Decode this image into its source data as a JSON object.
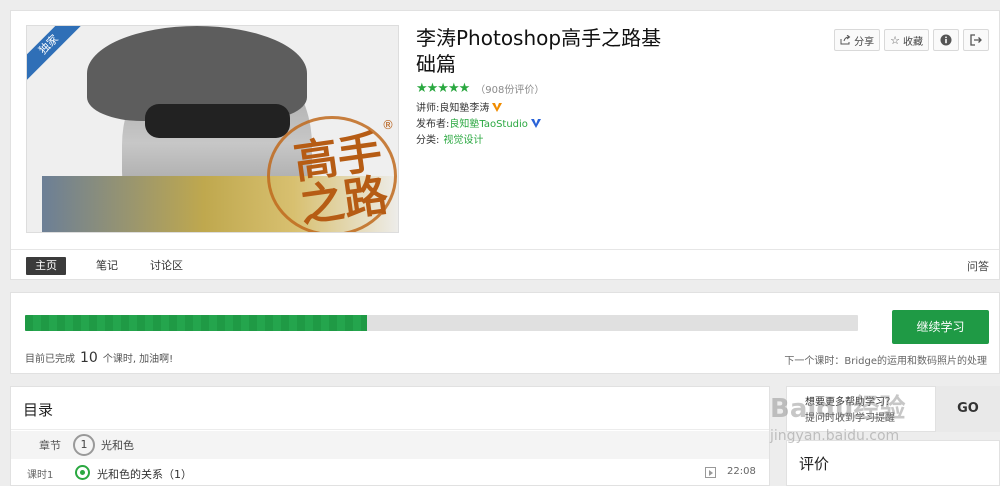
{
  "course": {
    "badge": "独家",
    "title": "李涛Photoshop高手之路基础篇",
    "stars": "★★★★★",
    "reviews": "（908份评价）",
    "instructor_label": "讲师:",
    "instructor": "良知塾李涛",
    "publisher_label": "发布者:",
    "publisher": "良知塾TaoStudio",
    "category_label": "分类:",
    "category": "视觉设计",
    "seal_text": "高手之路",
    "seal_reg": "®"
  },
  "actions": {
    "share": "分享",
    "favorite": "收藏"
  },
  "tabs": [
    {
      "label": "主页"
    },
    {
      "label": "笔记"
    },
    {
      "label": "讨论区"
    }
  ],
  "help": "问答",
  "progress": {
    "percent": 41,
    "completed_prefix": "目前已完成",
    "completed_count": "10",
    "completed_suffix": "个课时, 加油啊!",
    "continue_label": "继续学习",
    "next_lesson": "下一个课时：Bridge的运用和数码照片的处理"
  },
  "toc": {
    "title": "目录",
    "chapter_label": "章节",
    "chapter_number": "1",
    "chapter_name": "光和色",
    "lessons": [
      {
        "label": "课时1",
        "name": "光和色的关系（1）",
        "duration": "22:08"
      }
    ]
  },
  "side": {
    "ask_line1": "想要更多帮助学习？",
    "ask_line2": "提问时收到学习提醒",
    "go_label": "GO",
    "review_title": "评价"
  },
  "watermark": {
    "text": "Baidu经验",
    "url": "jingyan.baidu.com"
  },
  "colors": {
    "accent": "#1f9a45",
    "badge": "#2f6fb7",
    "verified_orange": "#f08c00",
    "verified_blue": "#2a63d8"
  }
}
